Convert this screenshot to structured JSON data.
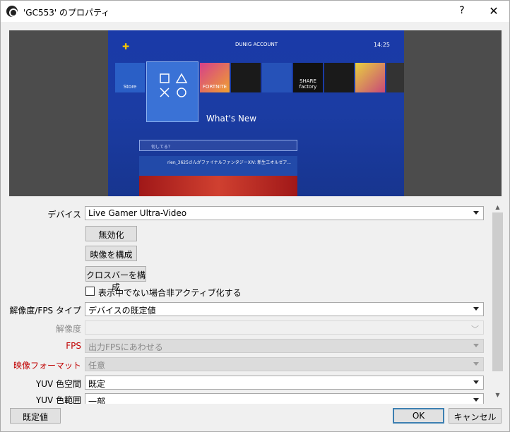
{
  "window": {
    "title": "'GC553' のプロパティ",
    "help_label": "?",
    "close_label": "✕"
  },
  "preview": {
    "ps4": {
      "time": "14:25",
      "account": "DUNIG ACCOUNT",
      "store_label": "Store",
      "whats_new": "What's New",
      "search_placeholder": "何してる？",
      "news_text": "rien_3625さんがファイナルファンタジーXIV: 新生エオルゼア...",
      "tiles": [
        "FORTNITE",
        "SHARE factory"
      ]
    }
  },
  "form": {
    "device": {
      "label": "デバイス",
      "value": "Live Gamer Ultra-Video"
    },
    "disable_button": "無効化",
    "configure_video_button": "映像を構成",
    "configure_crossbar_button": "クロスバーを構成",
    "deactivate_checkbox": {
      "label": "表示中でない場合非アクティブ化する",
      "checked": false
    },
    "resolution_fps_type": {
      "label": "解像度/FPS タイプ",
      "value": "デバイスの既定値"
    },
    "resolution": {
      "label": "解像度",
      "value": ""
    },
    "fps": {
      "label": "FPS",
      "value": "出力FPSにあわせる"
    },
    "video_format": {
      "label": "映像フォーマット",
      "value": "任意"
    },
    "yuv_color_space": {
      "label": "YUV 色空間",
      "value": "既定"
    },
    "yuv_color_range": {
      "label": "YUV 色範囲",
      "value": "一部"
    }
  },
  "footer": {
    "defaults_button": "既定値",
    "ok_button": "OK",
    "cancel_button": "キャンセル"
  },
  "colors": {
    "accent_red": "#c00000",
    "ok_border": "#3c7fb1"
  }
}
